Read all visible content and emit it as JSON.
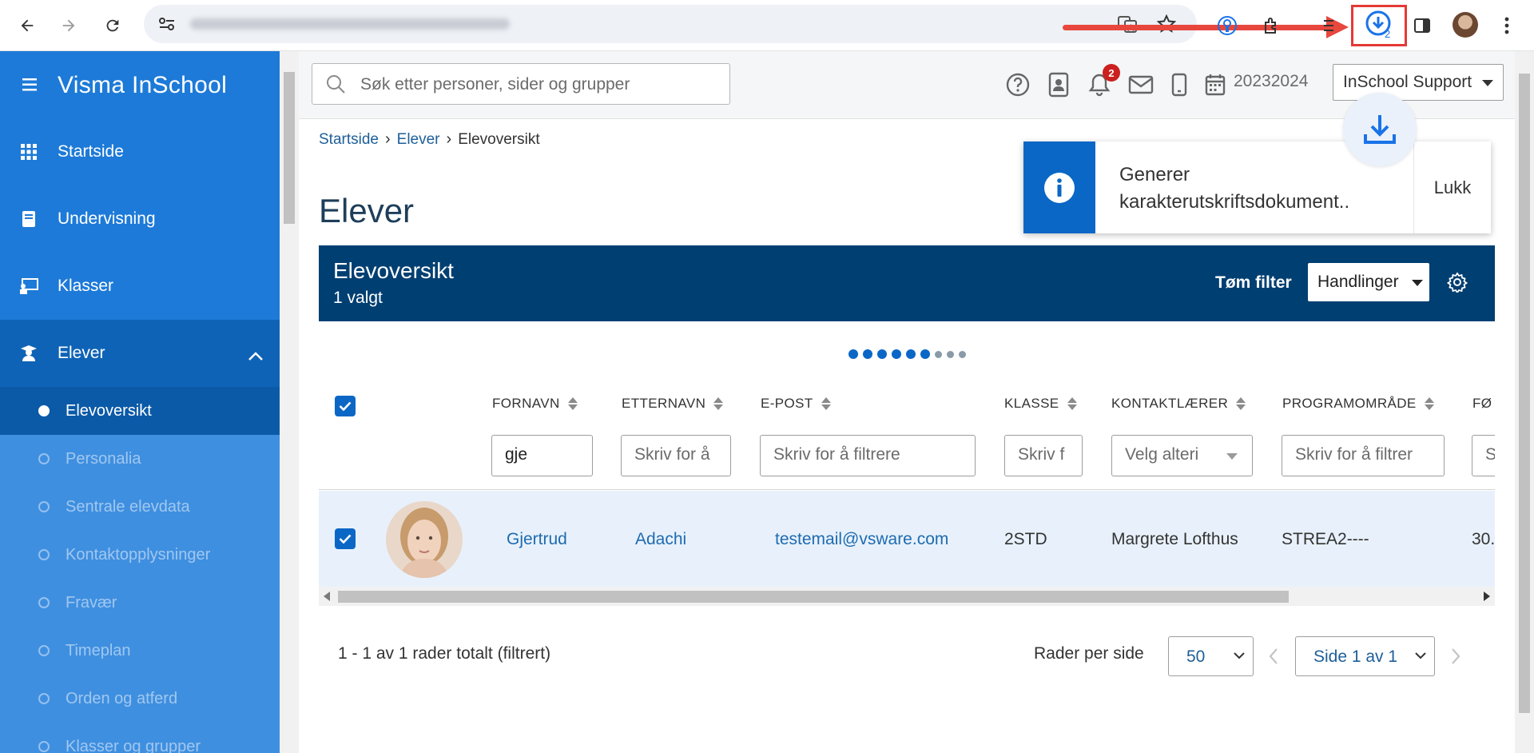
{
  "browser": {
    "download_count": "2"
  },
  "sidebar": {
    "brand": "Visma InSchool",
    "items": [
      {
        "label": "Startside"
      },
      {
        "label": "Undervisning"
      },
      {
        "label": "Klasser"
      }
    ],
    "section": {
      "label": "Elever"
    },
    "subitems": [
      {
        "label": "Elevoversikt",
        "active": true
      },
      {
        "label": "Personalia"
      },
      {
        "label": "Sentrale elevdata"
      },
      {
        "label": "Kontaktopplysninger"
      },
      {
        "label": "Fravær"
      },
      {
        "label": "Timeplan"
      },
      {
        "label": "Orden og atferd"
      },
      {
        "label": "Klasser og grupper"
      }
    ]
  },
  "topbar": {
    "search_placeholder": "Søk etter personer, sider og grupper",
    "notification_count": "2",
    "school_year": "20232024",
    "user": "InSchool Support"
  },
  "breadcrumb": [
    "Startside",
    "Elever",
    "Elevoversikt"
  ],
  "page_title": "Elever",
  "toast": {
    "message": "Generer karakterutskriftsdokument..",
    "close_label": "Lukk"
  },
  "panel": {
    "title": "Elevoversikt",
    "selected": "1 valgt",
    "clear_filter": "Tøm filter",
    "actions": "Handlinger"
  },
  "table": {
    "columns": [
      "FORNAVN",
      "ETTERNAVN",
      "E-POST",
      "KLASSE",
      "KONTAKTLÆRER",
      "PROGRAMOMRÅDE",
      "FØ"
    ],
    "filters": {
      "fornavn": "gje",
      "etternavn": "Skriv for å",
      "epost": "Skriv for å filtrere",
      "klasse": "Skriv f",
      "kontaktlaerer": "Velg alteri",
      "programomrade": "Skriv for å filtrer",
      "fo": "S"
    },
    "rows": [
      {
        "fornavn": "Gjertrud",
        "etternavn": "Adachi",
        "epost": "testemail@vsware.com",
        "klasse": "2STD",
        "kontaktlaerer": "Margrete Lofthus",
        "programomrade": "STREA2----",
        "fo": "30."
      }
    ]
  },
  "footer": {
    "total": "1 - 1 av 1 rader totalt (filtrert)",
    "rows_per_page_label": "Rader per side",
    "rows_per_page": "50",
    "page": "Side 1 av 1"
  }
}
